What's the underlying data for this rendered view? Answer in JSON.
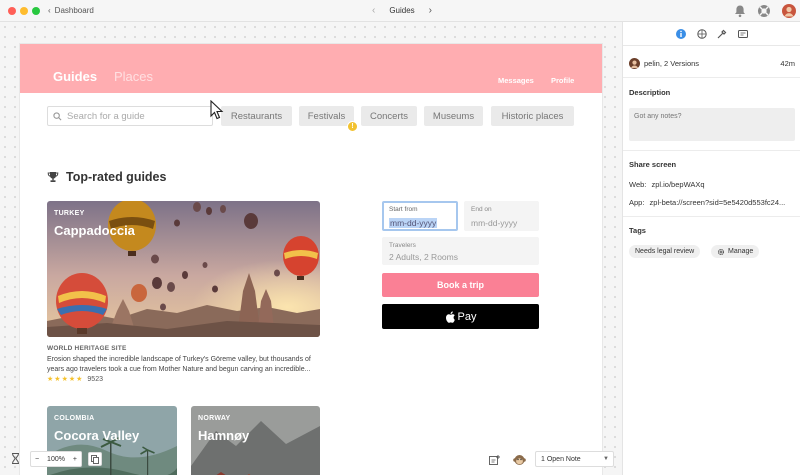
{
  "titlebar": {
    "back_label": "Dashboard",
    "screen_name": "Guides"
  },
  "app": {
    "nav": {
      "brand": "Guides",
      "places": "Places",
      "messages": "Messages",
      "profile": "Profile"
    },
    "search": {
      "placeholder": "Search for a guide"
    },
    "categories": [
      "Restaurants",
      "Festivals",
      "Concerts",
      "Museums",
      "Historic places"
    ],
    "badge": "!",
    "section_title": "Top-rated guides",
    "featured": {
      "country": "TURKEY",
      "title": "Cappadoccia",
      "category": "WORLD HERITAGE SITE",
      "description": "Erosion shaped the incredible landscape of Turkey's Göreme valley, but thousands of years ago travelers took a cue from Mother Nature and begun carving an incredible...",
      "stars": 5,
      "reviews": "9523"
    },
    "cards": [
      {
        "country": "COLOMBIA",
        "title": "Cocora Valley"
      },
      {
        "country": "NORWAY",
        "title": "Hamnøy"
      }
    ],
    "booking": {
      "start_label": "Start from",
      "start_value": "mm-dd-yyyy",
      "end_label": "End on",
      "end_value": "mm-dd-yyyy",
      "travelers_label": "Travelers",
      "travelers_value": "2 Adults, 2 Rooms",
      "book_label": "Book a trip",
      "applepay_label": "Pay"
    }
  },
  "canvas_controls": {
    "zoom_minus": "−",
    "zoom_level": "100%",
    "zoom_plus": "+",
    "note_select": "1 Open Note"
  },
  "sidebar": {
    "author": "pelin, 2 Versions",
    "time": "42m",
    "description_heading": "Description",
    "notes_placeholder": "Got any notes?",
    "share_heading": "Share screen",
    "web_label": "Web:",
    "web_value": "zpl.io/bepWAXq",
    "app_label": "App:",
    "app_value": "zpl-beta://screen?sid=5e5420d553fc24...",
    "tags_heading": "Tags",
    "tags": [
      "Needs legal review",
      "Manage"
    ]
  },
  "colors": {
    "header": "#ffadb1",
    "book_button": "#fa8095",
    "star": "#f5c22e",
    "info_tab": "#3a8ee6"
  }
}
